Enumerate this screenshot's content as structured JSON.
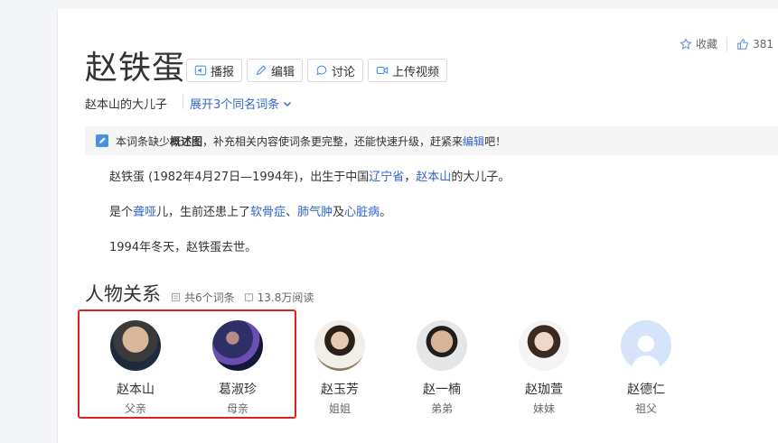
{
  "title": "赵铁蛋",
  "buttons": {
    "broadcast": "播报",
    "edit": "编辑",
    "discuss": "讨论",
    "upload_video": "上传视频"
  },
  "subtitle": "赵本山的大儿子",
  "expand_link": "展开3个同名词条",
  "actions": {
    "favorite": "收藏",
    "like_count": "381"
  },
  "notice": {
    "prefix": "本词条缺少",
    "bold": "概述图",
    "middle": "，补充相关内容使词条更完整，还能快速升级，赶紧来",
    "link": "编辑",
    "suffix": "吧！"
  },
  "paragraphs": {
    "p1": {
      "a": "赵铁蛋 (1982年4月27日—1994年)，出生于中国",
      "link1": "辽宁省",
      "b": "，",
      "link2": "赵本山",
      "c": "的大儿子。"
    },
    "p2": {
      "a": "是个",
      "link1": "聋哑",
      "b": "儿，生前还患上了",
      "link2": "软骨症",
      "c": "、",
      "link3": "肺气肿",
      "d": "及",
      "link4": "心脏病",
      "e": "。"
    },
    "p3": "1994年冬天，赵铁蛋去世。"
  },
  "relations": {
    "title": "人物关系",
    "entries": "共6个词条",
    "views": "13.8万阅读",
    "people": [
      {
        "name": "赵本山",
        "relation": "父亲"
      },
      {
        "name": "葛淑珍",
        "relation": "母亲"
      },
      {
        "name": "赵玉芳",
        "relation": "姐姐"
      },
      {
        "name": "赵一楠",
        "relation": "弟弟"
      },
      {
        "name": "赵珈萱",
        "relation": "妹妹"
      },
      {
        "name": "赵德仁",
        "relation": "祖父"
      }
    ]
  },
  "colors": {
    "link": "#3366cc",
    "highlight_box": "#e02020"
  }
}
